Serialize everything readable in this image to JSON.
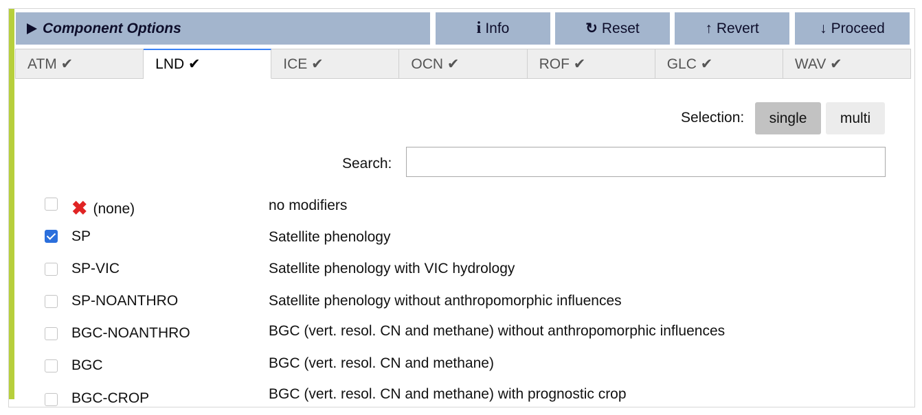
{
  "header": {
    "title": "Component Options",
    "buttons": {
      "info": "Info",
      "reset": "Reset",
      "revert": "Revert",
      "proceed": "Proceed"
    }
  },
  "tabs": [
    {
      "label": "ATM ✔",
      "active": false
    },
    {
      "label": "LND ✔",
      "active": true
    },
    {
      "label": "ICE ✔",
      "active": false
    },
    {
      "label": "OCN ✔",
      "active": false
    },
    {
      "label": "ROF ✔",
      "active": false
    },
    {
      "label": "GLC ✔",
      "active": false
    },
    {
      "label": "WAV ✔",
      "active": false
    }
  ],
  "selection": {
    "label": "Selection:",
    "single": "single",
    "multi": "multi",
    "selected": "single"
  },
  "search": {
    "label": "Search:",
    "value": ""
  },
  "options": [
    {
      "name": "(none)",
      "description": "no modifiers",
      "checked": false,
      "icon": "red-x-icon"
    },
    {
      "name": "SP",
      "description": "Satellite phenology",
      "checked": true
    },
    {
      "name": "SP-VIC",
      "description": "Satellite phenology with VIC hydrology",
      "checked": false
    },
    {
      "name": "SP-NOANTHRO",
      "description": "Satellite phenology without anthropomorphic influences",
      "checked": false
    },
    {
      "name": "BGC-NOANTHRO",
      "description": "BGC (vert. resol. CN and methane) without anthropomorphic influences",
      "checked": false
    },
    {
      "name": "BGC",
      "description": "BGC (vert. resol. CN and methane)",
      "checked": false
    },
    {
      "name": "BGC-CROP",
      "description": "BGC (vert. resol. CN and methane) with prognostic crop",
      "checked": false
    }
  ],
  "colors": {
    "accent": "#b7cf3c",
    "header_bg": "#a3b5cd",
    "checkbox_checked": "#2b6fdc",
    "active_tab_border": "#3b82f6"
  }
}
